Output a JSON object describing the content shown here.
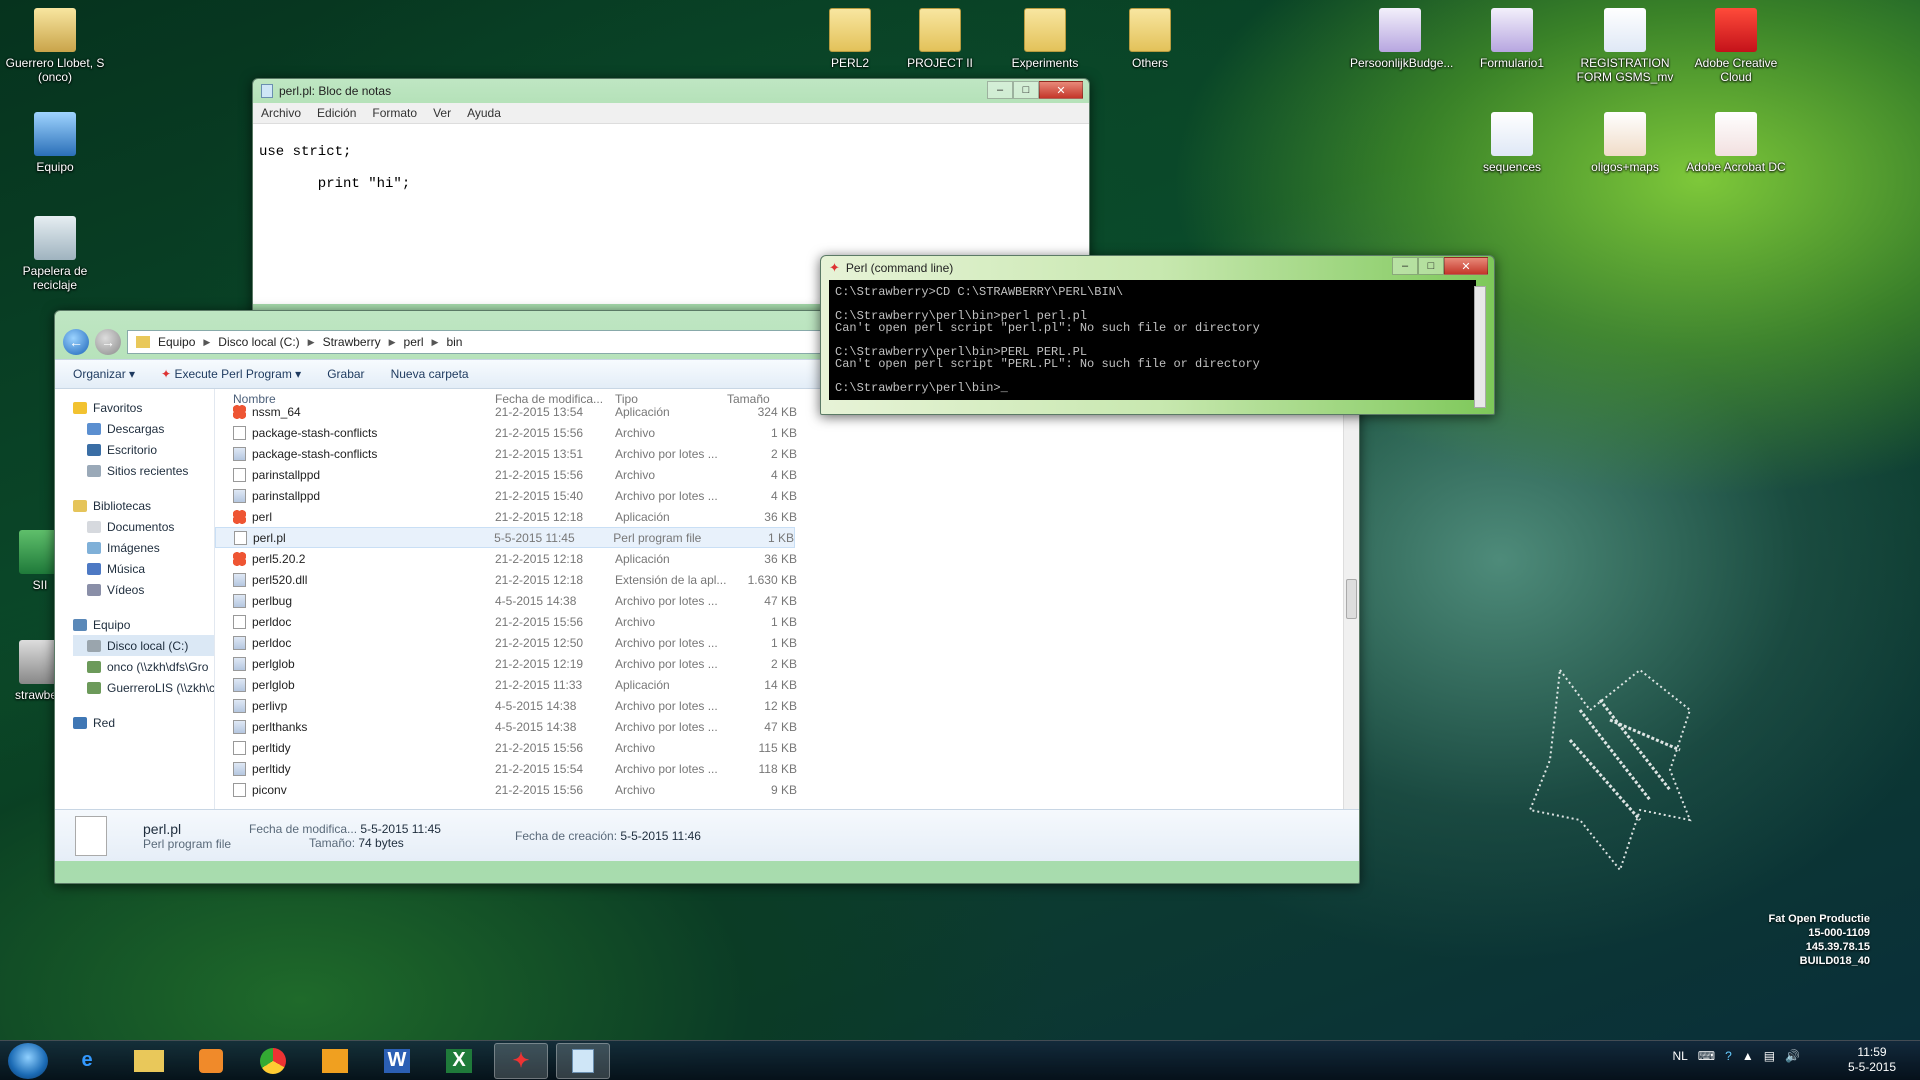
{
  "desktop_icons": [
    {
      "label": "Guerrero Llobet, S (onco)",
      "kind": "user",
      "icon": "user-folder-icon"
    },
    {
      "label": "Equipo",
      "kind": "computer",
      "icon": "computer-icon"
    },
    {
      "label": "Papelera de reciclaje",
      "kind": "bin",
      "icon": "recycle-bin-icon"
    },
    {
      "label": "SII",
      "kind": "excel",
      "icon": "excel-icon"
    },
    {
      "label": "strawberr",
      "kind": "perl",
      "icon": "strawberry-icon"
    },
    {
      "label": "PERL2",
      "kind": "folder",
      "icon": "folder-icon"
    },
    {
      "label": "PROJECT II",
      "kind": "folder",
      "icon": "folder-icon"
    },
    {
      "label": "Experiments",
      "kind": "folder",
      "icon": "folder-icon"
    },
    {
      "label": "Others",
      "kind": "folder",
      "icon": "folder-icon"
    },
    {
      "label": "PersoonlijkBudge...",
      "kind": "onenote",
      "icon": "onenote-icon"
    },
    {
      "label": "Formulario1",
      "kind": "onenote",
      "icon": "onenote-icon"
    },
    {
      "label": "REGISTRATION FORM GSMS_mv",
      "kind": "word",
      "icon": "word-icon"
    },
    {
      "label": "Adobe Creative Cloud",
      "kind": "adobe",
      "icon": "creative-cloud-icon"
    },
    {
      "label": "sequences",
      "kind": "word",
      "icon": "word-icon"
    },
    {
      "label": "oligos+maps",
      "kind": "ppt",
      "icon": "powerpoint-icon"
    },
    {
      "label": "Adobe Acrobat DC",
      "kind": "acrobat",
      "icon": "acrobat-icon"
    }
  ],
  "notepad": {
    "title": "perl.pl: Bloc de notas",
    "menu": [
      "Archivo",
      "Edición",
      "Formato",
      "Ver",
      "Ayuda"
    ],
    "content": "use strict;\n\n       print \"hi\";"
  },
  "cmd": {
    "title": "Perl (command line)",
    "content": "C:\\Strawberry>CD C:\\STRAWBERRY\\PERL\\BIN\\\n\nC:\\Strawberry\\perl\\bin>perl perl.pl\nCan't open perl script \"perl.pl\": No such file or directory\n\nC:\\Strawberry\\perl\\bin>PERL PERL.PL\nCan't open perl script \"PERL.PL\": No such file or directory\n\nC:\\Strawberry\\perl\\bin>_"
  },
  "explorer": {
    "breadcrumb": [
      "Equipo",
      "Disco local (C:)",
      "Strawberry",
      "perl",
      "bin"
    ],
    "toolbar": {
      "organize": "Organizar",
      "execute": "Execute Perl Program",
      "burn": "Grabar",
      "new_folder": "Nueva carpeta"
    },
    "nav": {
      "favorites": "Favoritos",
      "downloads": "Descargas",
      "desktop": "Escritorio",
      "recent": "Sitios recientes",
      "libraries": "Bibliotecas",
      "documents": "Documentos",
      "images": "Imágenes",
      "music": "Música",
      "videos": "Vídeos",
      "computer": "Equipo",
      "local_disk": "Disco local (C:)",
      "onco": "onco (\\\\zkh\\dfs\\Gro",
      "guerrero": "GuerreroLIS (\\\\zkh\\c",
      "network": "Red"
    },
    "columns": {
      "name": "Nombre",
      "date": "Fecha de modifica...",
      "type": "Tipo",
      "size": "Tamaño"
    },
    "files": [
      {
        "name": "nssm_64",
        "date": "21-2-2015 13:54",
        "type": "Aplicación",
        "size": "324 KB",
        "icon": "app"
      },
      {
        "name": "package-stash-conflicts",
        "date": "21-2-2015 15:56",
        "type": "Archivo",
        "size": "1 KB",
        "icon": "file"
      },
      {
        "name": "package-stash-conflicts",
        "date": "21-2-2015 13:51",
        "type": "Archivo por lotes ...",
        "size": "2 KB",
        "icon": "bat"
      },
      {
        "name": "parinstallppd",
        "date": "21-2-2015 15:56",
        "type": "Archivo",
        "size": "4 KB",
        "icon": "file"
      },
      {
        "name": "parinstallppd",
        "date": "21-2-2015 15:40",
        "type": "Archivo por lotes ...",
        "size": "4 KB",
        "icon": "bat"
      },
      {
        "name": "perl",
        "date": "21-2-2015 12:18",
        "type": "Aplicación",
        "size": "36 KB",
        "icon": "app"
      },
      {
        "name": "perl.pl",
        "date": "5-5-2015 11:45",
        "type": "Perl program file",
        "size": "1 KB",
        "icon": "file"
      },
      {
        "name": "perl5.20.2",
        "date": "21-2-2015 12:18",
        "type": "Aplicación",
        "size": "36 KB",
        "icon": "app"
      },
      {
        "name": "perl520.dll",
        "date": "21-2-2015 12:18",
        "type": "Extensión de la apl...",
        "size": "1.630 KB",
        "icon": "bat"
      },
      {
        "name": "perlbug",
        "date": "4-5-2015 14:38",
        "type": "Archivo por lotes ...",
        "size": "47 KB",
        "icon": "bat"
      },
      {
        "name": "perldoc",
        "date": "21-2-2015 15:56",
        "type": "Archivo",
        "size": "1 KB",
        "icon": "file"
      },
      {
        "name": "perldoc",
        "date": "21-2-2015 12:50",
        "type": "Archivo por lotes ...",
        "size": "1 KB",
        "icon": "bat"
      },
      {
        "name": "perlglob",
        "date": "21-2-2015 12:19",
        "type": "Archivo por lotes ...",
        "size": "2 KB",
        "icon": "bat"
      },
      {
        "name": "perlglob",
        "date": "21-2-2015 11:33",
        "type": "Aplicación",
        "size": "14 KB",
        "icon": "bat"
      },
      {
        "name": "perlivp",
        "date": "4-5-2015 14:38",
        "type": "Archivo por lotes ...",
        "size": "12 KB",
        "icon": "bat"
      },
      {
        "name": "perlthanks",
        "date": "4-5-2015 14:38",
        "type": "Archivo por lotes ...",
        "size": "47 KB",
        "icon": "bat"
      },
      {
        "name": "perltidy",
        "date": "21-2-2015 15:56",
        "type": "Archivo",
        "size": "115 KB",
        "icon": "file"
      },
      {
        "name": "perltidy",
        "date": "21-2-2015 15:54",
        "type": "Archivo por lotes ...",
        "size": "118 KB",
        "icon": "bat"
      },
      {
        "name": "piconv",
        "date": "21-2-2015 15:56",
        "type": "Archivo",
        "size": "9 KB",
        "icon": "file"
      }
    ],
    "selected_index": 6,
    "details": {
      "name": "perl.pl",
      "type": "Perl program file",
      "modified_label": "Fecha de modifica...",
      "modified": "5-5-2015 11:45",
      "size_label": "Tamaño:",
      "size": "74 bytes",
      "created_label": "Fecha de creación:",
      "created": "5-5-2015 11:46"
    }
  },
  "build_info": [
    "Fat Open Productie",
    "15-000-1109",
    "145.39.78.15",
    "BUILD018_40"
  ],
  "taskbar": {
    "apps": [
      "internet-explorer-icon",
      "file-explorer-icon",
      "media-player-icon",
      "chrome-icon",
      "outlook-icon",
      "word-icon",
      "excel-icon",
      "perl-icon",
      "notepad-icon"
    ],
    "lang": "NL",
    "time": "11:59",
    "date": "5-5-2015"
  }
}
